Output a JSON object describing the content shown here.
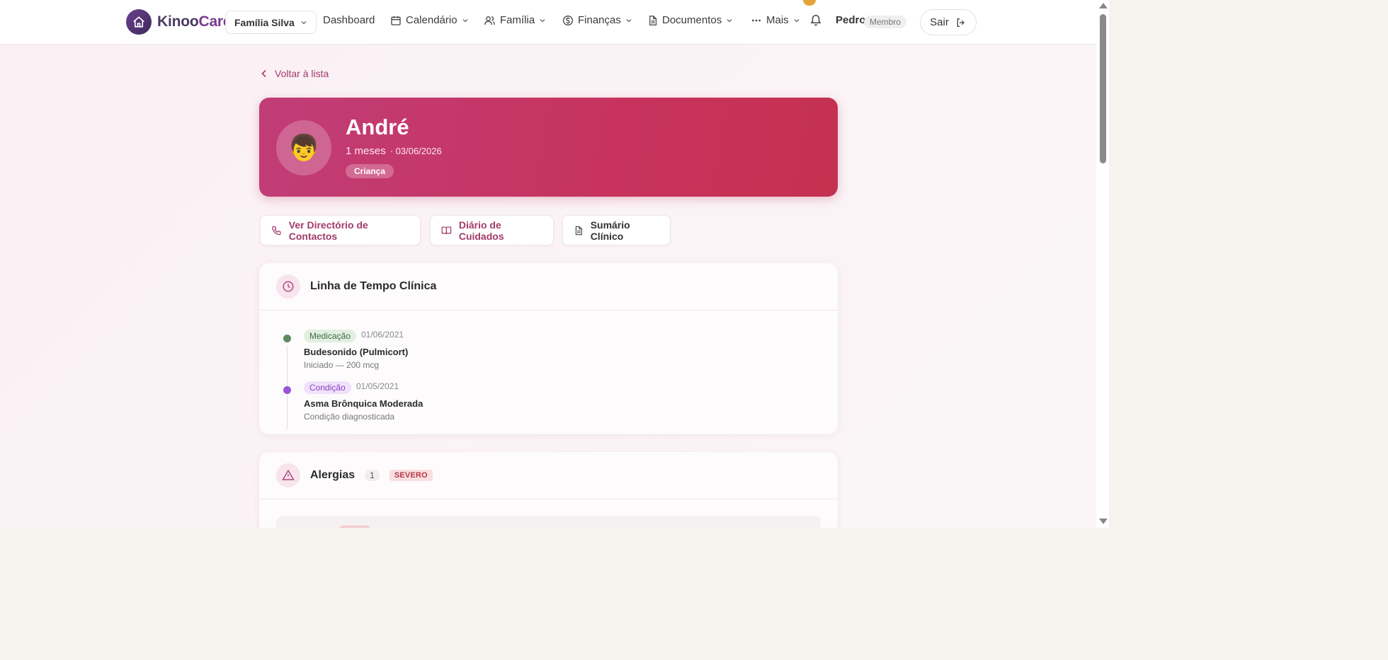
{
  "app": {
    "name_part1": "Kinoo",
    "name_part2": "Care"
  },
  "nav": {
    "family_select": "Família Silva",
    "dashboard": "Dashboard",
    "calendar": "Calendário",
    "family": "Família",
    "finance": "Finanças",
    "documents": "Documentos",
    "more": "Mais",
    "user_name": "Pedro",
    "user_role": "Membro",
    "logout": "Sair"
  },
  "back_link": "Voltar à lista",
  "profile": {
    "avatar_emoji": "👦",
    "name": "André",
    "age": "1 meses",
    "birthdate": "· 03/06/2026",
    "tag": "Criança"
  },
  "actions": {
    "contacts": "Ver Directório de Contactos",
    "care_diary": "Diário de Cuidados",
    "clinical_summary": "Sumário Clínico"
  },
  "timeline": {
    "title": "Linha de Tempo Clínica",
    "items": [
      {
        "type": "Medicação",
        "date": "01/06/2021",
        "title": "Budesonido (Pulmicort)",
        "subtitle": "Iniciado — 200 mcg",
        "color": "#5e8a62"
      },
      {
        "type": "Condição",
        "date": "01/05/2021",
        "title": "Asma Brônquica Moderada",
        "subtitle": "Condição diagnosticada",
        "color": "#9a55d6"
      }
    ]
  },
  "allergies": {
    "title": "Alergias",
    "count": "1",
    "severity": "SEVERO"
  },
  "colors": {
    "accent": "#a23a6a",
    "hero_start": "#c13d78",
    "hero_end": "#c43150"
  }
}
